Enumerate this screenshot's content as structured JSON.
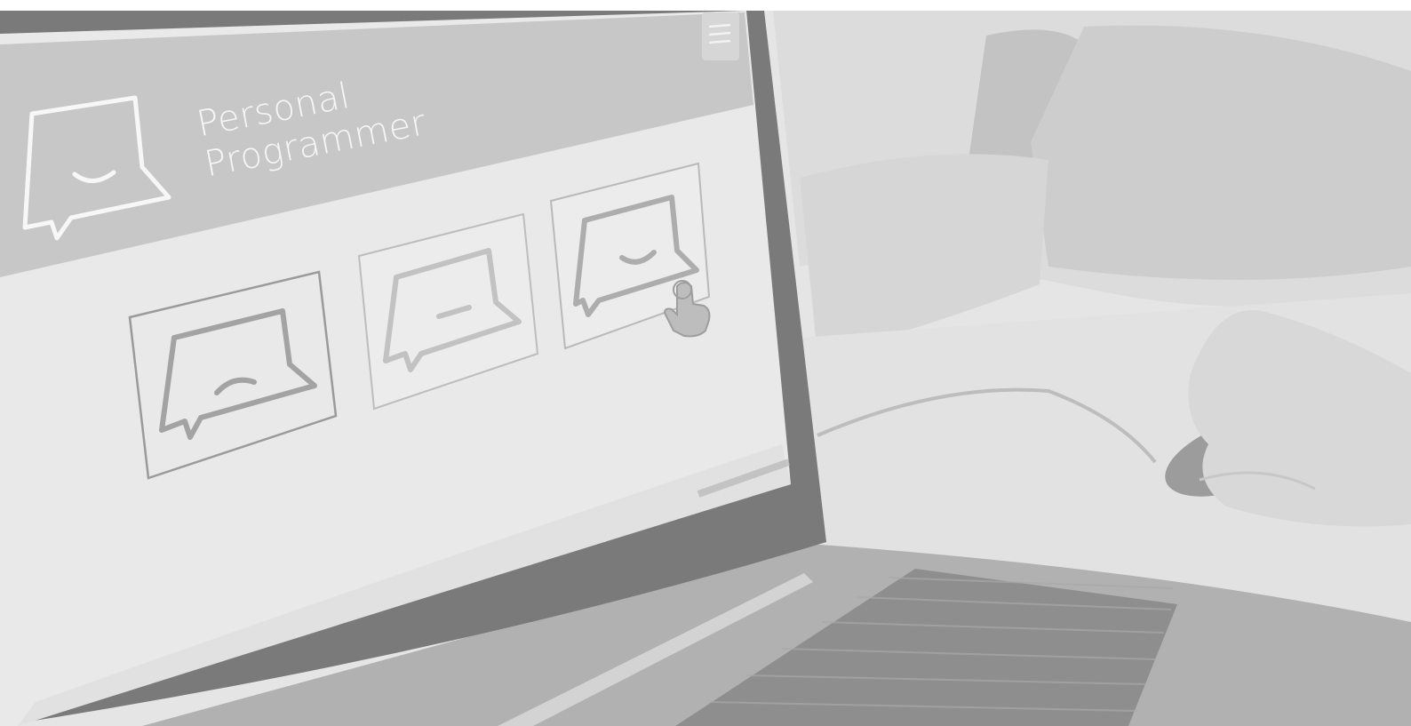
{
  "brand": {
    "line1": "Personal",
    "line2": "Programmer"
  },
  "icons": {
    "menu": "hamburger-menu-icon",
    "logo": "speech-bubble-smile-icon",
    "sad": "speech-bubble-frown-icon",
    "neutral": "speech-bubble-neutral-icon",
    "happy": "speech-bubble-smile-icon",
    "cursor": "hand-pointer-icon"
  },
  "colors": {
    "header": "#c6c6c6",
    "screen": "#e9e9e9",
    "laptop_body": "#9a9a9a",
    "keyboard": "#8a8a8a",
    "background": "#e4e4e4"
  }
}
